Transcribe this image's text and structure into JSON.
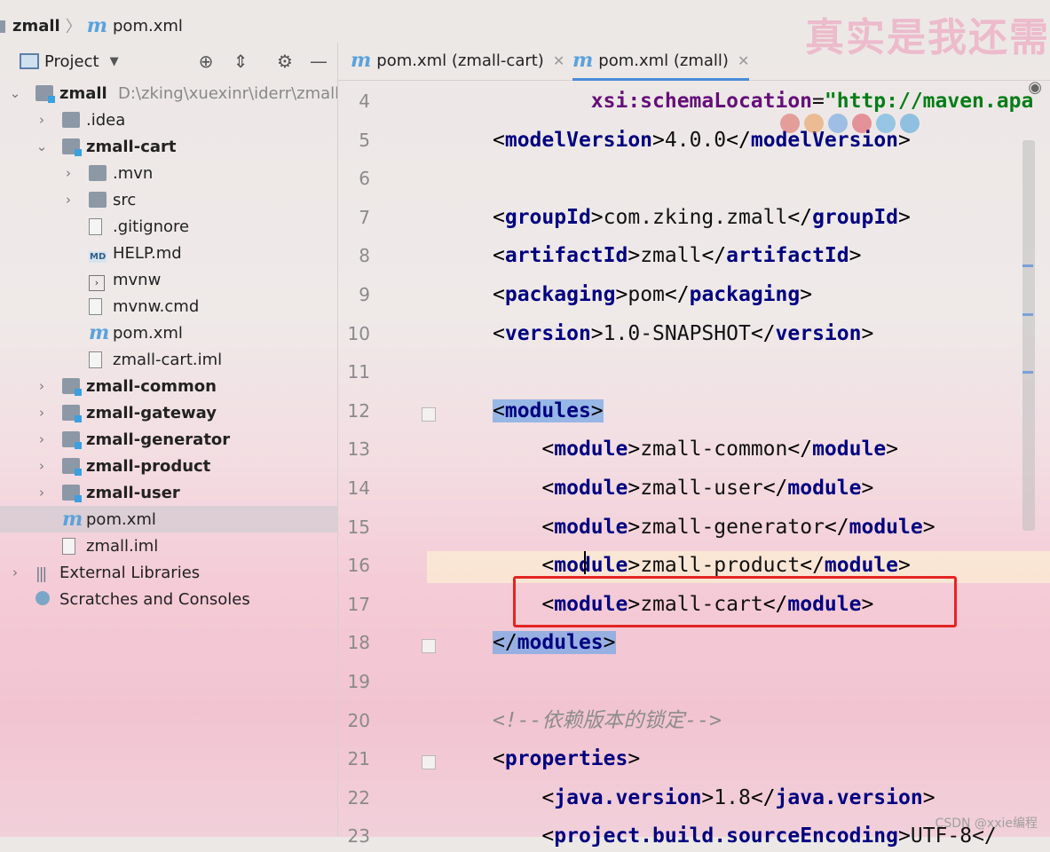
{
  "breadcrumb": {
    "project": "zmall",
    "file": "pom.xml",
    "file_icon": "m"
  },
  "watermark": "真实是我还需",
  "project_panel": {
    "title": "Project",
    "tree": [
      {
        "label": "zmall",
        "hint": "D:\\zking\\xuexinr\\iderr\\zmall",
        "depth": 0,
        "expanded": true,
        "icon": "module-folder-icon",
        "bold": true
      },
      {
        "label": ".idea",
        "depth": 1,
        "expanded": false,
        "icon": "folder-icon"
      },
      {
        "label": "zmall-cart",
        "depth": 1,
        "expanded": true,
        "icon": "module-folder-icon",
        "bold": true
      },
      {
        "label": ".mvn",
        "depth": 2,
        "expanded": false,
        "icon": "folder-icon"
      },
      {
        "label": "src",
        "depth": 2,
        "expanded": false,
        "icon": "folder-icon"
      },
      {
        "label": ".gitignore",
        "depth": 2,
        "icon": "gitignore-file-icon"
      },
      {
        "label": "HELP.md",
        "depth": 2,
        "icon": "markdown-file-icon"
      },
      {
        "label": "mvnw",
        "depth": 2,
        "icon": "shell-file-icon"
      },
      {
        "label": "mvnw.cmd",
        "depth": 2,
        "icon": "text-file-icon"
      },
      {
        "label": "pom.xml",
        "depth": 2,
        "icon": "maven-file-icon"
      },
      {
        "label": "zmall-cart.iml",
        "depth": 2,
        "icon": "iml-file-icon"
      },
      {
        "label": "zmall-common",
        "depth": 1,
        "expanded": false,
        "icon": "module-folder-icon",
        "bold": true
      },
      {
        "label": "zmall-gateway",
        "depth": 1,
        "expanded": false,
        "icon": "module-folder-icon",
        "bold": true
      },
      {
        "label": "zmall-generator",
        "depth": 1,
        "expanded": false,
        "icon": "module-folder-icon",
        "bold": true
      },
      {
        "label": "zmall-product",
        "depth": 1,
        "expanded": false,
        "icon": "module-folder-icon",
        "bold": true
      },
      {
        "label": "zmall-user",
        "depth": 1,
        "expanded": false,
        "icon": "module-folder-icon",
        "bold": true
      },
      {
        "label": "pom.xml",
        "depth": 1,
        "icon": "maven-file-icon",
        "selected": true
      },
      {
        "label": "zmall.iml",
        "depth": 1,
        "icon": "iml-file-icon"
      },
      {
        "label": "External Libraries",
        "depth": 0,
        "expanded": false,
        "icon": "libraries-icon"
      },
      {
        "label": "Scratches and Consoles",
        "depth": 0,
        "icon": "scratches-icon"
      }
    ]
  },
  "tabs": [
    {
      "label": "pom.xml (zmall-cart)",
      "active": false
    },
    {
      "label": "pom.xml (zmall)",
      "active": true
    }
  ],
  "editor": {
    "lines": [
      {
        "n": "4",
        "text": "        xsi:schemaLocation=\"http://maven.apa"
      },
      {
        "n": "5",
        "text": "<modelVersion>4.0.0</modelVersion>"
      },
      {
        "n": "6",
        "text": ""
      },
      {
        "n": "7",
        "text": "<groupId>com.zking.zmall</groupId>"
      },
      {
        "n": "8",
        "text": "<artifactId>zmall</artifactId>"
      },
      {
        "n": "9",
        "text": "<packaging>pom</packaging>"
      },
      {
        "n": "10",
        "text": "<version>1.0-SNAPSHOT</version>"
      },
      {
        "n": "11",
        "text": ""
      },
      {
        "n": "12",
        "text": "<modules>"
      },
      {
        "n": "13",
        "text": "    <module>zmall-common</module>"
      },
      {
        "n": "14",
        "text": "    <module>zmall-user</module>"
      },
      {
        "n": "15",
        "text": "    <module>zmall-generator</module>"
      },
      {
        "n": "16",
        "text": "    <module>zmall-product</module>"
      },
      {
        "n": "17",
        "text": "    <module>zmall-cart</module>"
      },
      {
        "n": "18",
        "text": "</modules>"
      },
      {
        "n": "19",
        "text": ""
      },
      {
        "n": "20",
        "text": "<!--依赖版本的锁定-->"
      },
      {
        "n": "21",
        "text": "<properties>"
      },
      {
        "n": "22",
        "text": "    <java.version>1.8</java.version>"
      },
      {
        "n": "23",
        "text": "    <project.build.sourceEncoding>UTF-8</"
      }
    ],
    "highlighted_block": "modules",
    "current_line": "16",
    "boxed_line": "17"
  },
  "footer": {
    "credit": "CSDN @xxie编程"
  },
  "colors": {
    "tag": "#000080",
    "string": "#067d17",
    "attribute": "#660e7a",
    "comment": "#8c8c8c",
    "highlight_box": "#e52424"
  }
}
